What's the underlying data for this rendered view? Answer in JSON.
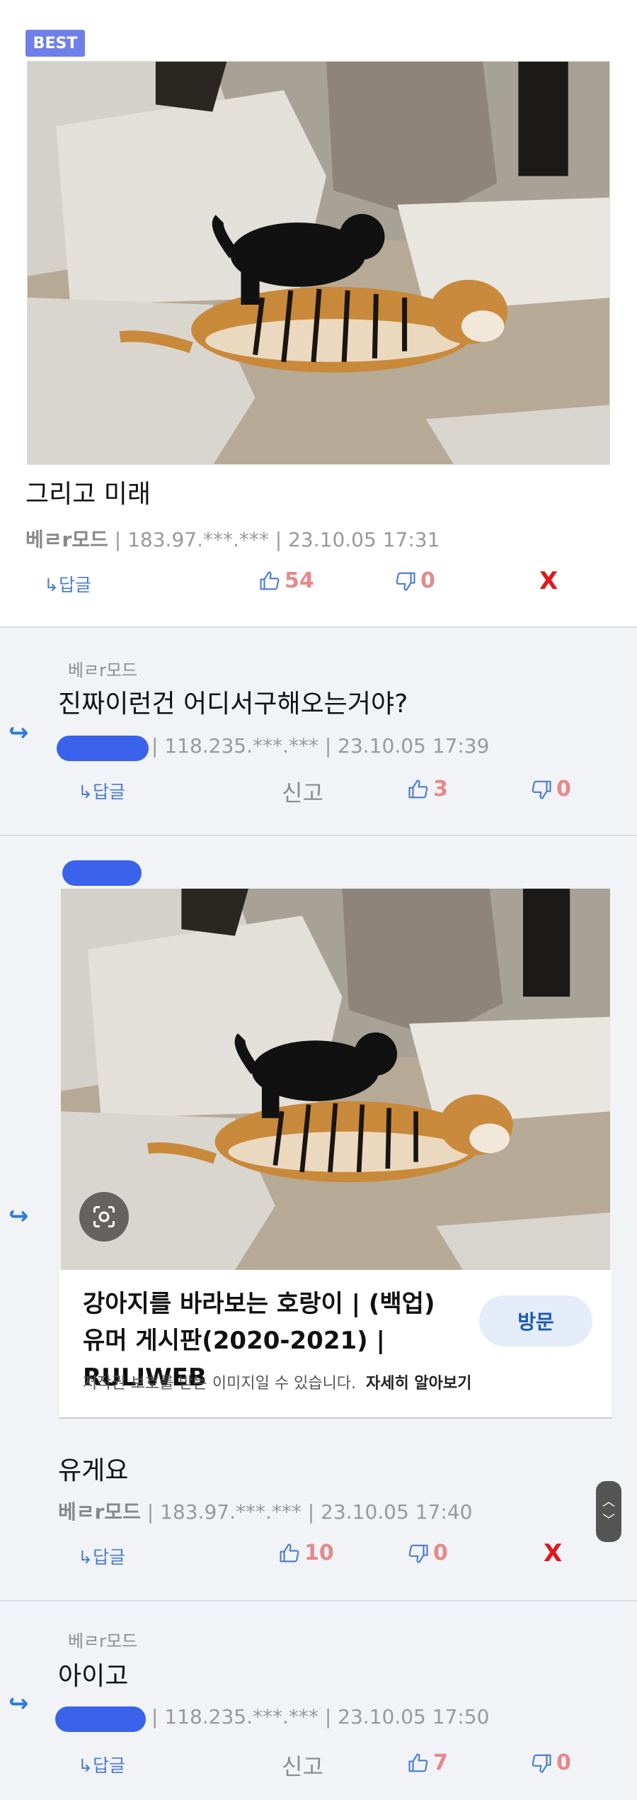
{
  "best_badge": "BEST",
  "post": {
    "comment_text": "그리고 미래",
    "author": "베ㄹr모드",
    "meta": "| 183.97.***.*** | 23.10.05 17:31",
    "reply_label": "↳답글",
    "likes": "54",
    "dislikes": "0",
    "delete_label": "X"
  },
  "reply1": {
    "parent": "베ㄹr모드",
    "text": "진짜이런건 어디서구해오는거야?",
    "meta": "| 118.235.***.*** | 23.10.05 17:39",
    "reply_label": "↳답글",
    "report_label": "신고",
    "likes": "3",
    "dislikes": "0"
  },
  "reply2": {
    "card": {
      "title": "강아지를 바라보는 호랑이 | (백업)유머 게시판(2020-2021) | RULIWEB",
      "visit_label": "방문",
      "copyright": "저작권 보호를 받는 이미지일 수 있습니다.",
      "learn_more": "자세히 알아보기"
    },
    "text": "유게요",
    "author": "베ㄹr모드",
    "meta": "| 183.97.***.*** | 23.10.05 17:40",
    "reply_label": "↳답글",
    "likes": "10",
    "dislikes": "0",
    "delete_label": "X"
  },
  "reply3": {
    "parent": "베ㄹr모드",
    "text": "아이고",
    "meta": "| 118.235.***.*** | 23.10.05 17:50",
    "reply_label": "↳답글",
    "report_label": "신고",
    "likes": "7",
    "dislikes": "0"
  },
  "icons": {
    "reply_arrow": "reply-arrow-icon",
    "like": "thumbs-up-icon",
    "dislike": "thumbs-down-icon",
    "lens": "google-lens-icon"
  },
  "colors": {
    "badge": "#6e80e8",
    "vote": "#e7888a",
    "delete": "#e3161a",
    "link": "#4a7bd0",
    "reply_bg": "#f1f3f6"
  }
}
